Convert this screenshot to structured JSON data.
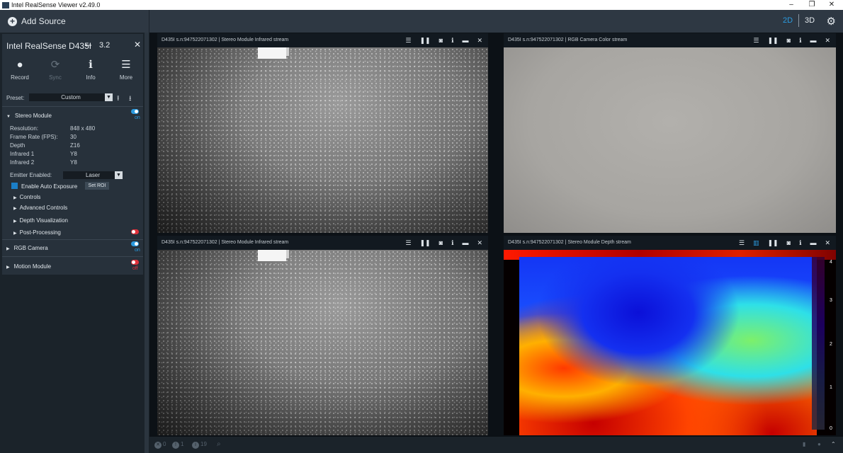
{
  "window": {
    "title": "Intel RealSense Viewer v2.49.0",
    "minimize": "–",
    "restore": "❐",
    "close": "✕"
  },
  "topbar": {
    "add_source_label": "Add Source",
    "mode_2d": "2D",
    "mode_3d": "3D",
    "accent_color": "#2b9be0"
  },
  "device": {
    "name": "Intel RealSense D435I",
    "usb_version": "3.2",
    "toolbar": [
      {
        "label": "Record",
        "icon": "●"
      },
      {
        "label": "Sync",
        "icon": "⟳"
      },
      {
        "label": "Info",
        "icon": "ℹ"
      },
      {
        "label": "More",
        "icon": "☰"
      }
    ],
    "preset_label": "Preset:",
    "preset_value": "Custom",
    "stereo": {
      "title": "Stereo Module",
      "state": "on",
      "props": [
        {
          "name": "Resolution:",
          "value": "848 x 480"
        },
        {
          "name": "Frame Rate (FPS):",
          "value": "30"
        },
        {
          "name": "Depth",
          "value": "Z16"
        },
        {
          "name": "Infrared 1",
          "value": "Y8"
        },
        {
          "name": "Infrared 2",
          "value": "Y8"
        }
      ],
      "emitter_label": "Emitter Enabled:",
      "emitter_value": "Laser",
      "auto_exposure_label": "Enable Auto Exposure",
      "set_roi_label": "Set ROI",
      "subsections": [
        "Controls",
        "Advanced Controls",
        "Depth Visualization",
        "Post-Processing"
      ]
    },
    "rgb": {
      "title": "RGB Camera",
      "state": "on"
    },
    "motion": {
      "title": "Motion Module",
      "state": "off"
    }
  },
  "streams": [
    {
      "title": "D435I s.n:947522071302 | Stereo Module Infrared stream"
    },
    {
      "title": "D435I s.n:947522071302 | RGB Camera Color stream"
    },
    {
      "title": "D435I s.n:947522071302 | Stereo Module Infrared stream"
    },
    {
      "title": "D435I s.n:947522071302 | Stereo Module Depth stream"
    }
  ],
  "depth_scale": [
    "4",
    "3",
    "2",
    "1",
    "0"
  ],
  "statusbar": {
    "errors": "0",
    "warnings": "1",
    "info": "19"
  }
}
